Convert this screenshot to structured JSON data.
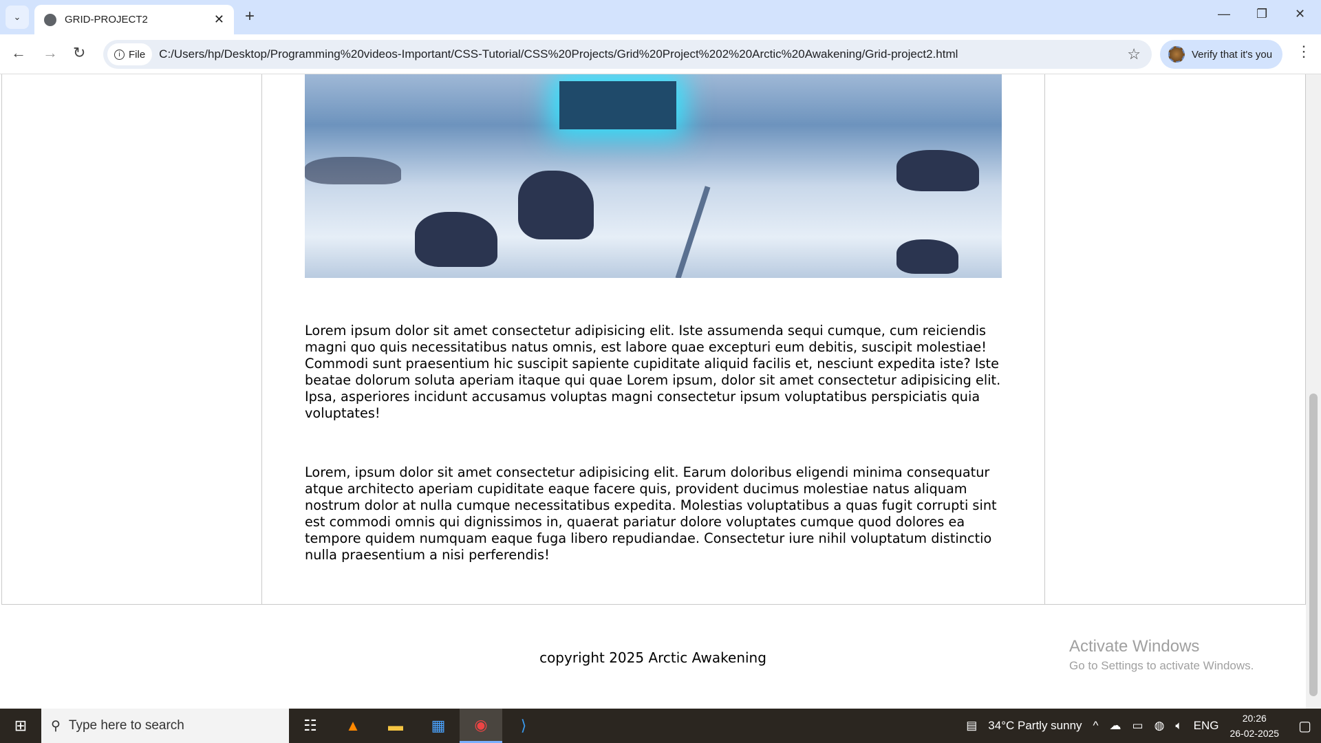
{
  "browser": {
    "tab_title": "GRID-PROJECT2",
    "site_chip": "File",
    "url": "C:/Users/hp/Desktop/Programming%20videos-Important/CSS-Tutorial/CSS%20Projects/Grid%20Project%202%20Arctic%20Awakening/Grid-project2.html",
    "verify_label": "Verify that it's you"
  },
  "content": {
    "paragraphs": [
      "Lorem ipsum dolor sit amet consectetur adipisicing elit. Iste assumenda sequi cumque, cum reiciendis magni quo quis necessitatibus natus omnis, est labore quae excepturi eum debitis, suscipit molestiae! Commodi sunt praesentium hic suscipit sapiente cupiditate aliquid facilis et, nesciunt expedita iste? Iste beatae dolorum soluta aperiam itaque qui quae Lorem ipsum, dolor sit amet consectetur adipisicing elit. Ipsa, asperiores incidunt accusamus voluptas magni consectetur ipsum voluptatibus perspiciatis quia voluptates!",
      "Lorem, ipsum dolor sit amet consectetur adipisicing elit. Earum doloribus eligendi minima consequatur atque architecto aperiam cupiditate eaque facere quis, provident ducimus molestiae natus aliquam nostrum dolor at nulla cumque necessitatibus expedita. Molestias voluptatibus a quas fugit corrupti sint est commodi omnis qui dignissimos in, quaerat pariatur dolore voluptates cumque quod dolores ea tempore quidem numquam eaque fuga libero repudiandae. Consectetur iure nihil voluptatum distinctio nulla praesentium a nisi perferendis!"
    ],
    "footer": "copyright 2025 Arctic Awakening"
  },
  "watermark": {
    "title": "Activate Windows",
    "subtitle": "Go to Settings to activate Windows."
  },
  "taskbar": {
    "search_placeholder": "Type here to search",
    "weather": "34°C  Partly sunny",
    "language": "ENG",
    "time": "20:26",
    "date": "26-02-2025"
  }
}
